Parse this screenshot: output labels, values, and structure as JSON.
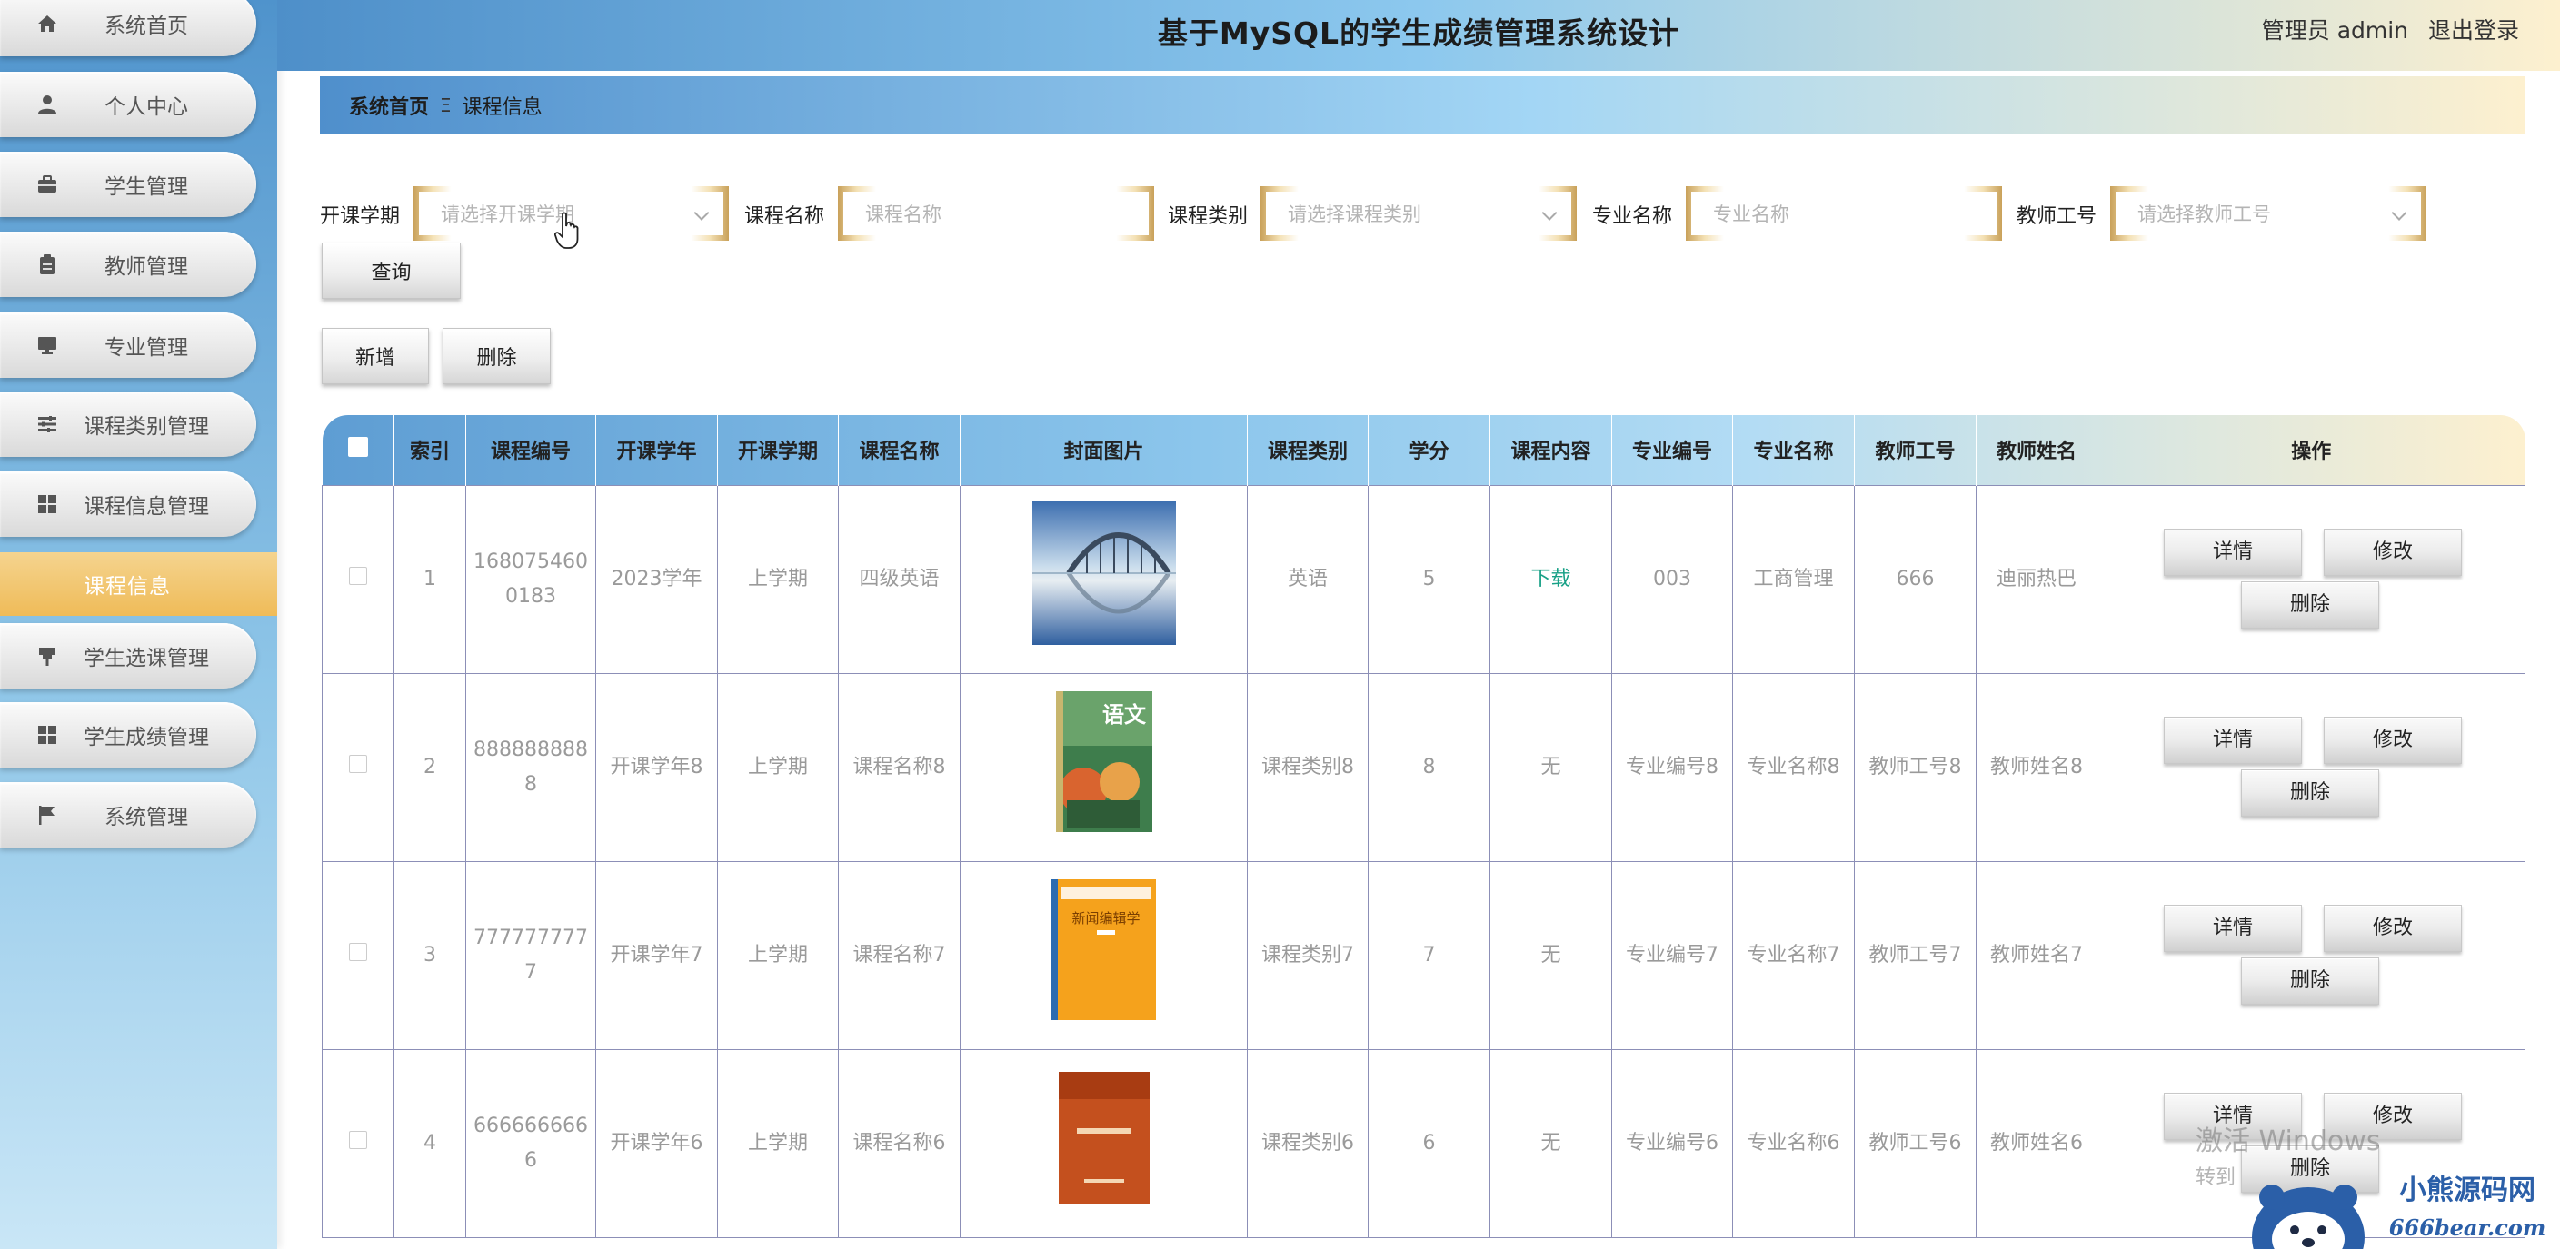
{
  "header": {
    "title": "基于MySQL的学生成绩管理系统设计",
    "user_label": "管理员 admin",
    "logout_label": "退出登录"
  },
  "sidebar": {
    "items": [
      {
        "label": "系统首页",
        "icon": "home-icon"
      },
      {
        "label": "个人中心",
        "icon": "user-icon"
      },
      {
        "label": "学生管理",
        "icon": "briefcase-icon"
      },
      {
        "label": "教师管理",
        "icon": "clipboard-icon"
      },
      {
        "label": "专业管理",
        "icon": "monitor-icon"
      },
      {
        "label": "课程类别管理",
        "icon": "list-icon"
      },
      {
        "label": "课程信息管理",
        "icon": "grid-icon"
      },
      {
        "label": "学生选课管理",
        "icon": "pushpin-icon"
      },
      {
        "label": "学生成绩管理",
        "icon": "grid-icon"
      },
      {
        "label": "系统管理",
        "icon": "flag-icon"
      }
    ],
    "active_sub": "课程信息"
  },
  "breadcrumb": {
    "home": "系统首页",
    "separator": "Ξ",
    "current": "课程信息"
  },
  "search": {
    "semester_label": "开课学期",
    "semester_placeholder": "请选择开课学期",
    "course_name_label": "课程名称",
    "course_name_placeholder": "课程名称",
    "category_label": "课程类别",
    "category_placeholder": "请选择课程类别",
    "major_label": "专业名称",
    "major_placeholder": "专业名称",
    "teacher_label": "教师工号",
    "teacher_placeholder": "请选择教师工号",
    "query_button": "查询"
  },
  "actions": {
    "add": "新增",
    "delete": "删除"
  },
  "table": {
    "columns": [
      "索引",
      "课程编号",
      "开课学年",
      "开课学期",
      "课程名称",
      "封面图片",
      "课程类别",
      "学分",
      "课程内容",
      "专业编号",
      "专业名称",
      "教师工号",
      "教师姓名",
      "操作"
    ],
    "row_buttons": {
      "detail": "详情",
      "edit": "修改",
      "delete": "删除"
    },
    "rows": [
      {
        "index": "1",
        "course_no": "1680754600183",
        "year": "2023学年",
        "semester": "上学期",
        "name": "四级英语",
        "cover": "bridge-lake-photo",
        "category": "英语",
        "credit": "5",
        "content": "下载",
        "major_no": "003",
        "major_name": "工商管理",
        "teacher_no": "666",
        "teacher_name": "迪丽热巴"
      },
      {
        "index": "2",
        "course_no": "8888888888",
        "year": "开课学年8",
        "semester": "上学期",
        "name": "课程名称8",
        "cover": "chinese-textbook-cover",
        "category": "课程类别8",
        "credit": "8",
        "content": "无",
        "major_no": "专业编号8",
        "major_name": "专业名称8",
        "teacher_no": "教师工号8",
        "teacher_name": "教师姓名8"
      },
      {
        "index": "3",
        "course_no": "7777777777",
        "year": "开课学年7",
        "semester": "上学期",
        "name": "课程名称7",
        "cover": "orange-book-cover",
        "category": "课程类别7",
        "credit": "7",
        "content": "无",
        "major_no": "专业编号7",
        "major_name": "专业名称7",
        "teacher_no": "教师工号7",
        "teacher_name": "教师姓名7"
      },
      {
        "index": "4",
        "course_no": "6666666666",
        "year": "开课学年6",
        "semester": "上学期",
        "name": "课程名称6",
        "cover": "red-book-cover",
        "category": "课程类别6",
        "credit": "6",
        "content": "无",
        "major_no": "专业编号6",
        "major_name": "专业名称6",
        "teacher_no": "教师工号6",
        "teacher_name": "教师姓名6"
      }
    ]
  },
  "cover_texts": {
    "chinese_book": "语文",
    "orange_book": "新闻编辑学"
  },
  "watermark": {
    "line1": "激活 Windows",
    "line2": "转到"
  },
  "site_logo": {
    "name": "小熊源码网",
    "url": "666bear.com"
  },
  "colors": {
    "accent_blue": "#4f8fcc",
    "accent_gold": "#efbb58",
    "download_link": "#17a086"
  }
}
